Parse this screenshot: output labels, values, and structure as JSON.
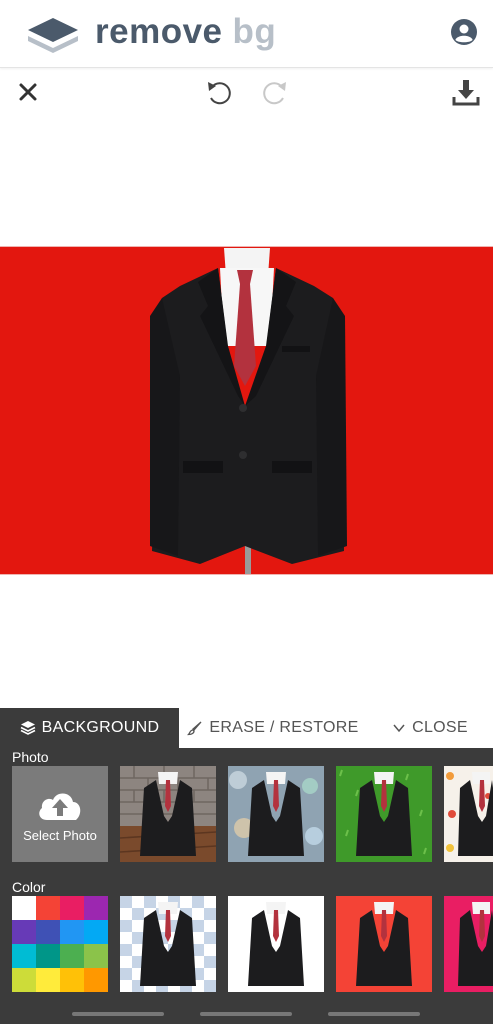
{
  "header": {
    "brand_primary": "remove",
    "brand_secondary": "bg"
  },
  "icons": {
    "logo": "layers-logo-icon",
    "account": "account-circle-icon",
    "close": "close-icon",
    "undo": "undo-icon",
    "redo": "redo-icon",
    "download": "download-icon"
  },
  "canvas": {
    "background_color": "#e3170f"
  },
  "panel": {
    "tabs": [
      {
        "label": "BACKGROUND",
        "icon": "layers-icon",
        "active": true
      },
      {
        "label": "ERASE / RESTORE",
        "icon": "brush-icon",
        "active": false
      },
      {
        "label": "CLOSE",
        "icon": "chevron-down-icon",
        "active": false
      }
    ],
    "photo_label": "Photo",
    "select_photo_label": "Select Photo",
    "photo_backgrounds": [
      "brick-wall-wood-floor",
      "bokeh-lights",
      "green-grass",
      "fruit-pattern"
    ],
    "color_label": "Color",
    "color_palette": [
      "#ffffff",
      "#f44336",
      "#e91e63",
      "#9c27b0",
      "#673ab7",
      "#3f51b5",
      "#2196f3",
      "#03a9f4",
      "#00bcd4",
      "#009688",
      "#4caf50",
      "#8bc34a",
      "#cddc39",
      "#ffeb3b",
      "#ffc107",
      "#ff9800"
    ],
    "color_backgrounds": [
      "transparent",
      "#ffffff",
      "#f44336",
      "#e91e63"
    ]
  }
}
